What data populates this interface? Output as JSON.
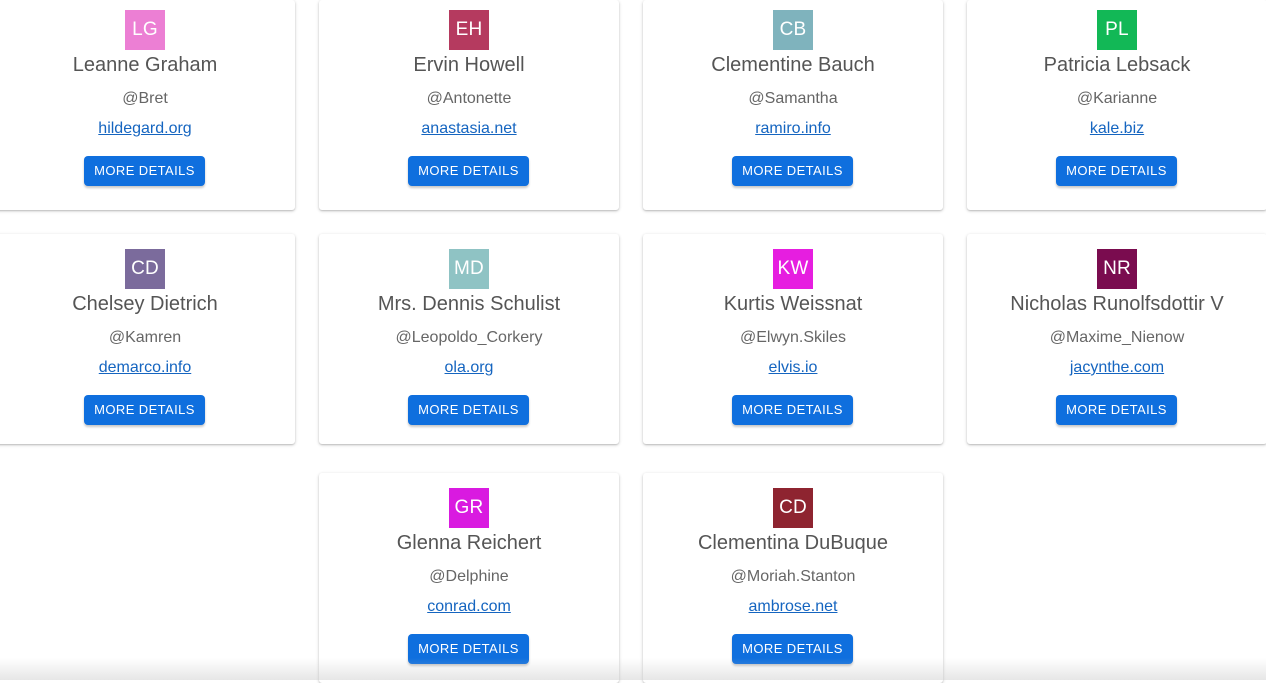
{
  "users": [
    {
      "initials": "LG",
      "avatar_color": "#ec7fd4",
      "name": "Leanne Graham",
      "username": "@Bret",
      "website": "hildegard.org",
      "button_label": "MORE DETAILS"
    },
    {
      "initials": "EH",
      "avatar_color": "#b53a5f",
      "name": "Ervin Howell",
      "username": "@Antonette",
      "website": "anastasia.net",
      "button_label": "MORE DETAILS"
    },
    {
      "initials": "CB",
      "avatar_color": "#7fb3bd",
      "name": "Clementine Bauch",
      "username": "@Samantha",
      "website": "ramiro.info",
      "button_label": "MORE DETAILS"
    },
    {
      "initials": "PL",
      "avatar_color": "#12b856",
      "name": "Patricia Lebsack",
      "username": "@Karianne",
      "website": "kale.biz",
      "button_label": "MORE DETAILS"
    },
    {
      "initials": "CD",
      "avatar_color": "#7b6b9c",
      "name": "Chelsey Dietrich",
      "username": "@Kamren",
      "website": "demarco.info",
      "button_label": "MORE DETAILS"
    },
    {
      "initials": "MD",
      "avatar_color": "#8fc3c4",
      "name": "Mrs. Dennis Schulist",
      "username": "@Leopoldo_Corkery",
      "website": "ola.org",
      "button_label": "MORE DETAILS"
    },
    {
      "initials": "KW",
      "avatar_color": "#e61ee0",
      "name": "Kurtis Weissnat",
      "username": "@Elwyn.Skiles",
      "website": "elvis.io",
      "button_label": "MORE DETAILS"
    },
    {
      "initials": "NR",
      "avatar_color": "#7a0c4f",
      "name": "Nicholas Runolfsdottir V",
      "username": "@Maxime_Nienow",
      "website": "jacynthe.com",
      "button_label": "MORE DETAILS"
    },
    {
      "initials": "GR",
      "avatar_color": "#d91ae0",
      "name": "Glenna Reichert",
      "username": "@Delphine",
      "website": "conrad.com",
      "button_label": "MORE DETAILS"
    },
    {
      "initials": "CD",
      "avatar_color": "#8e2430",
      "name": "Clementina DuBuque",
      "username": "@Moriah.Stanton",
      "website": "ambrose.net",
      "button_label": "MORE DETAILS"
    }
  ]
}
